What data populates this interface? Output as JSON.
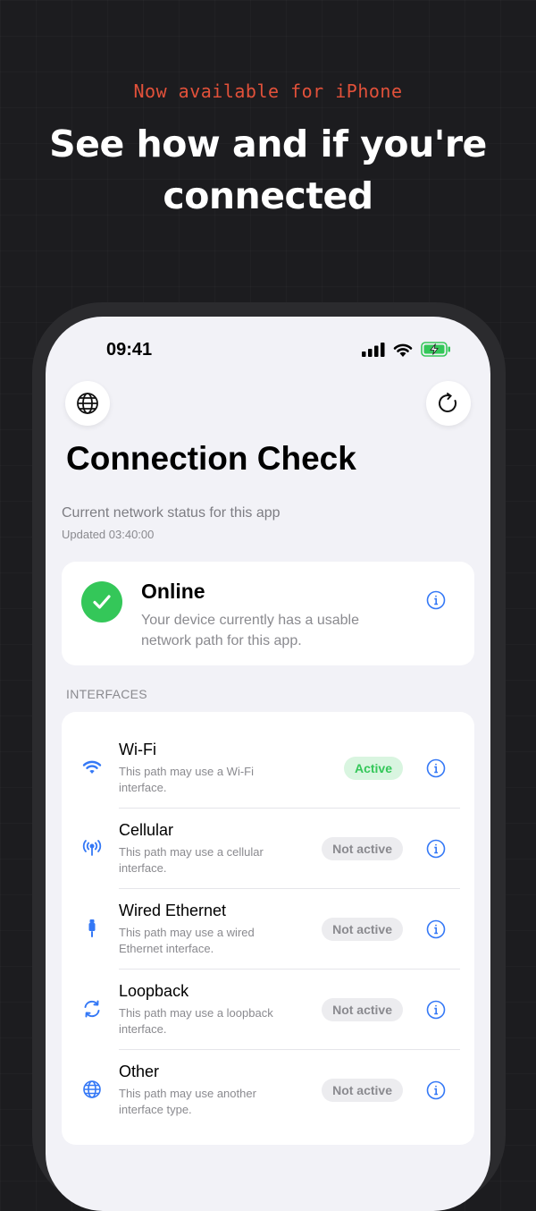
{
  "promo": {
    "tag": "Now available for iPhone",
    "headline_line1": "See how and if you're",
    "headline_line2": "connected"
  },
  "status_bar": {
    "time": "09:41"
  },
  "toolbar": {
    "left_icon": "globe-icon",
    "right_icon": "refresh-icon"
  },
  "page": {
    "title": "Connection Check",
    "subtitle": "Current network status for this app",
    "updated": "Updated 03:40:00"
  },
  "status_card": {
    "title": "Online",
    "description": "Your device currently has a usable network path for this app.",
    "icon": "checkmark-icon",
    "color": "#34c759"
  },
  "interfaces": {
    "section_label": "INTERFACES",
    "items": [
      {
        "name": "Wi-Fi",
        "description": "This path may use a Wi-Fi interface.",
        "status": "Active",
        "icon": "wifi-icon"
      },
      {
        "name": "Cellular",
        "description": "This path may use a cellular interface.",
        "status": "Not active",
        "icon": "cellular-antenna-icon"
      },
      {
        "name": "Wired Ethernet",
        "description": "This path may use a wired Ethernet interface.",
        "status": "Not active",
        "icon": "ethernet-cable-icon"
      },
      {
        "name": "Loopback",
        "description": "This path may use a loopback interface.",
        "status": "Not active",
        "icon": "loopback-icon"
      },
      {
        "name": "Other",
        "description": "This path may use another interface type.",
        "status": "Not active",
        "icon": "globe-icon"
      }
    ]
  },
  "colors": {
    "accent": "#3478f6",
    "promo_tag": "#e2513a",
    "active_badge_bg": "#d9f5e0",
    "inactive_badge_bg": "#ececef"
  }
}
